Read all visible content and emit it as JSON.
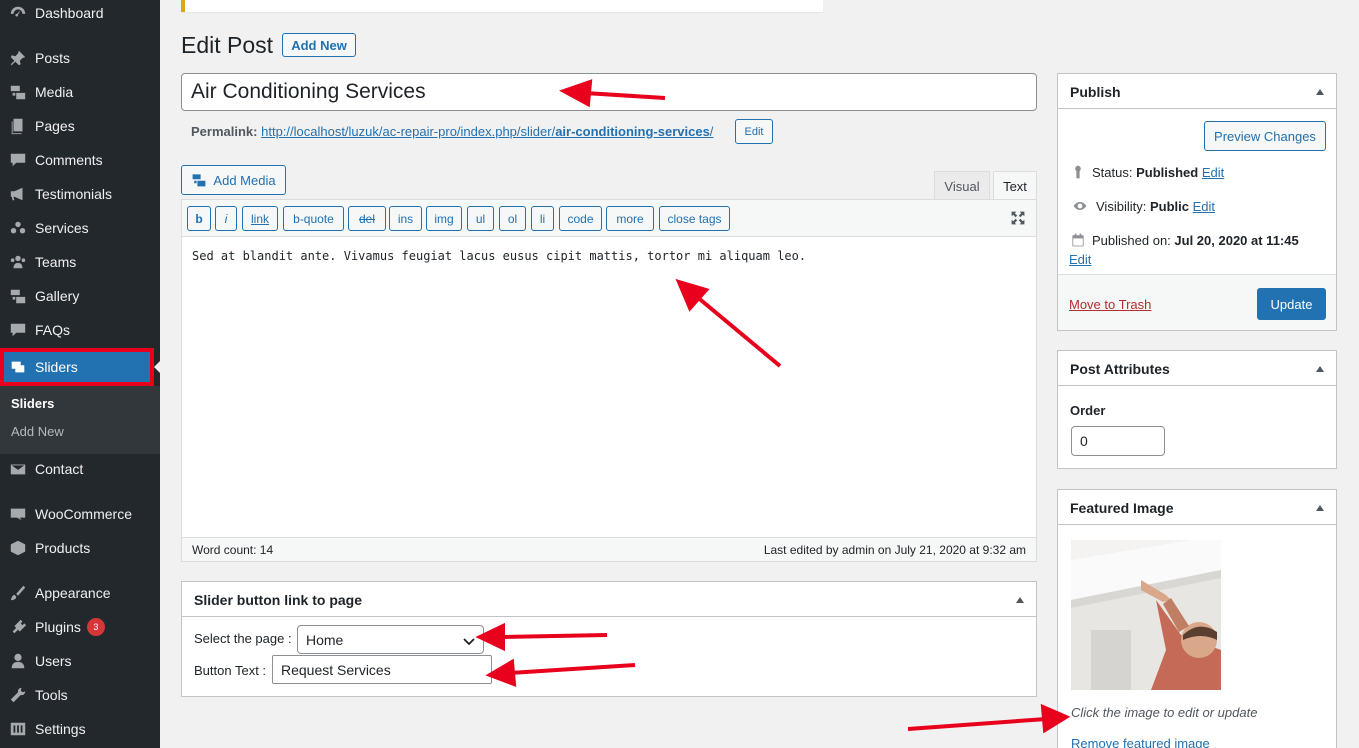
{
  "sidebar": {
    "items": [
      {
        "label": "Dashboard",
        "icon": "dashboard-icon"
      },
      {
        "label": "Posts",
        "icon": "pin-icon"
      },
      {
        "label": "Media",
        "icon": "media-icon"
      },
      {
        "label": "Pages",
        "icon": "pages-icon"
      },
      {
        "label": "Comments",
        "icon": "comment-icon"
      },
      {
        "label": "Testimonials",
        "icon": "megaphone-icon"
      },
      {
        "label": "Services",
        "icon": "groups-icon"
      },
      {
        "label": "Teams",
        "icon": "team-icon"
      },
      {
        "label": "Gallery",
        "icon": "gallery-icon"
      },
      {
        "label": "FAQs",
        "icon": "faq-icon"
      },
      {
        "label": "Sliders",
        "icon": "slides-icon"
      },
      {
        "label": "Contact",
        "icon": "mail-icon"
      },
      {
        "label": "WooCommerce",
        "icon": "woo-icon"
      },
      {
        "label": "Products",
        "icon": "box-icon"
      },
      {
        "label": "Appearance",
        "icon": "brush-icon"
      },
      {
        "label": "Plugins",
        "icon": "plugin-icon",
        "badge": "3"
      },
      {
        "label": "Users",
        "icon": "user-icon"
      },
      {
        "label": "Tools",
        "icon": "wrench-icon"
      },
      {
        "label": "Settings",
        "icon": "settings-icon"
      }
    ],
    "submenu": {
      "current": "Sliders",
      "add_new": "Add New"
    }
  },
  "header": {
    "title": "Edit Post",
    "add_new": "Add New"
  },
  "post": {
    "title": "Air Conditioning Services",
    "permalink_label": "Permalink:",
    "permalink_base": "http://localhost/luzuk/ac-repair-pro/index.php/slider/",
    "permalink_slug": "air-conditioning-services",
    "permalink_tail": "/",
    "permalink_edit": "Edit"
  },
  "editor": {
    "add_media": "Add Media",
    "tab_visual": "Visual",
    "tab_text": "Text",
    "buttons": [
      "b",
      "i",
      "link",
      "b-quote",
      "del",
      "ins",
      "img",
      "ul",
      "ol",
      "li",
      "code",
      "more",
      "close tags"
    ],
    "content": "Sed at blandit ante. Vivamus feugiat lacus eusus cipit mattis, tortor mi aliquam leo.",
    "word_count": "Word count: 14",
    "last_edited": "Last edited by admin on July 21, 2020 at 9:32 am"
  },
  "slider_box": {
    "title": "Slider button link to page",
    "select_label": "Select the page :",
    "select_value": "Home",
    "button_text_label": "Button Text :",
    "button_text_value": "Request Services"
  },
  "publish": {
    "title": "Publish",
    "preview": "Preview Changes",
    "status_label": "Status:",
    "status_value": "Published",
    "visibility_label": "Visibility:",
    "visibility_value": "Public",
    "published_label": "Published on:",
    "published_value": "Jul 20, 2020 at 11:45",
    "edit": "Edit",
    "trash": "Move to Trash",
    "update": "Update"
  },
  "attributes": {
    "title": "Post Attributes",
    "order_label": "Order",
    "order_value": "0"
  },
  "featured": {
    "title": "Featured Image",
    "hint": "Click the image to edit or update",
    "remove": "Remove featured image"
  },
  "colors": {
    "accent": "#2271b1",
    "sidebar": "#23282d",
    "annotation": "#e8001c"
  }
}
